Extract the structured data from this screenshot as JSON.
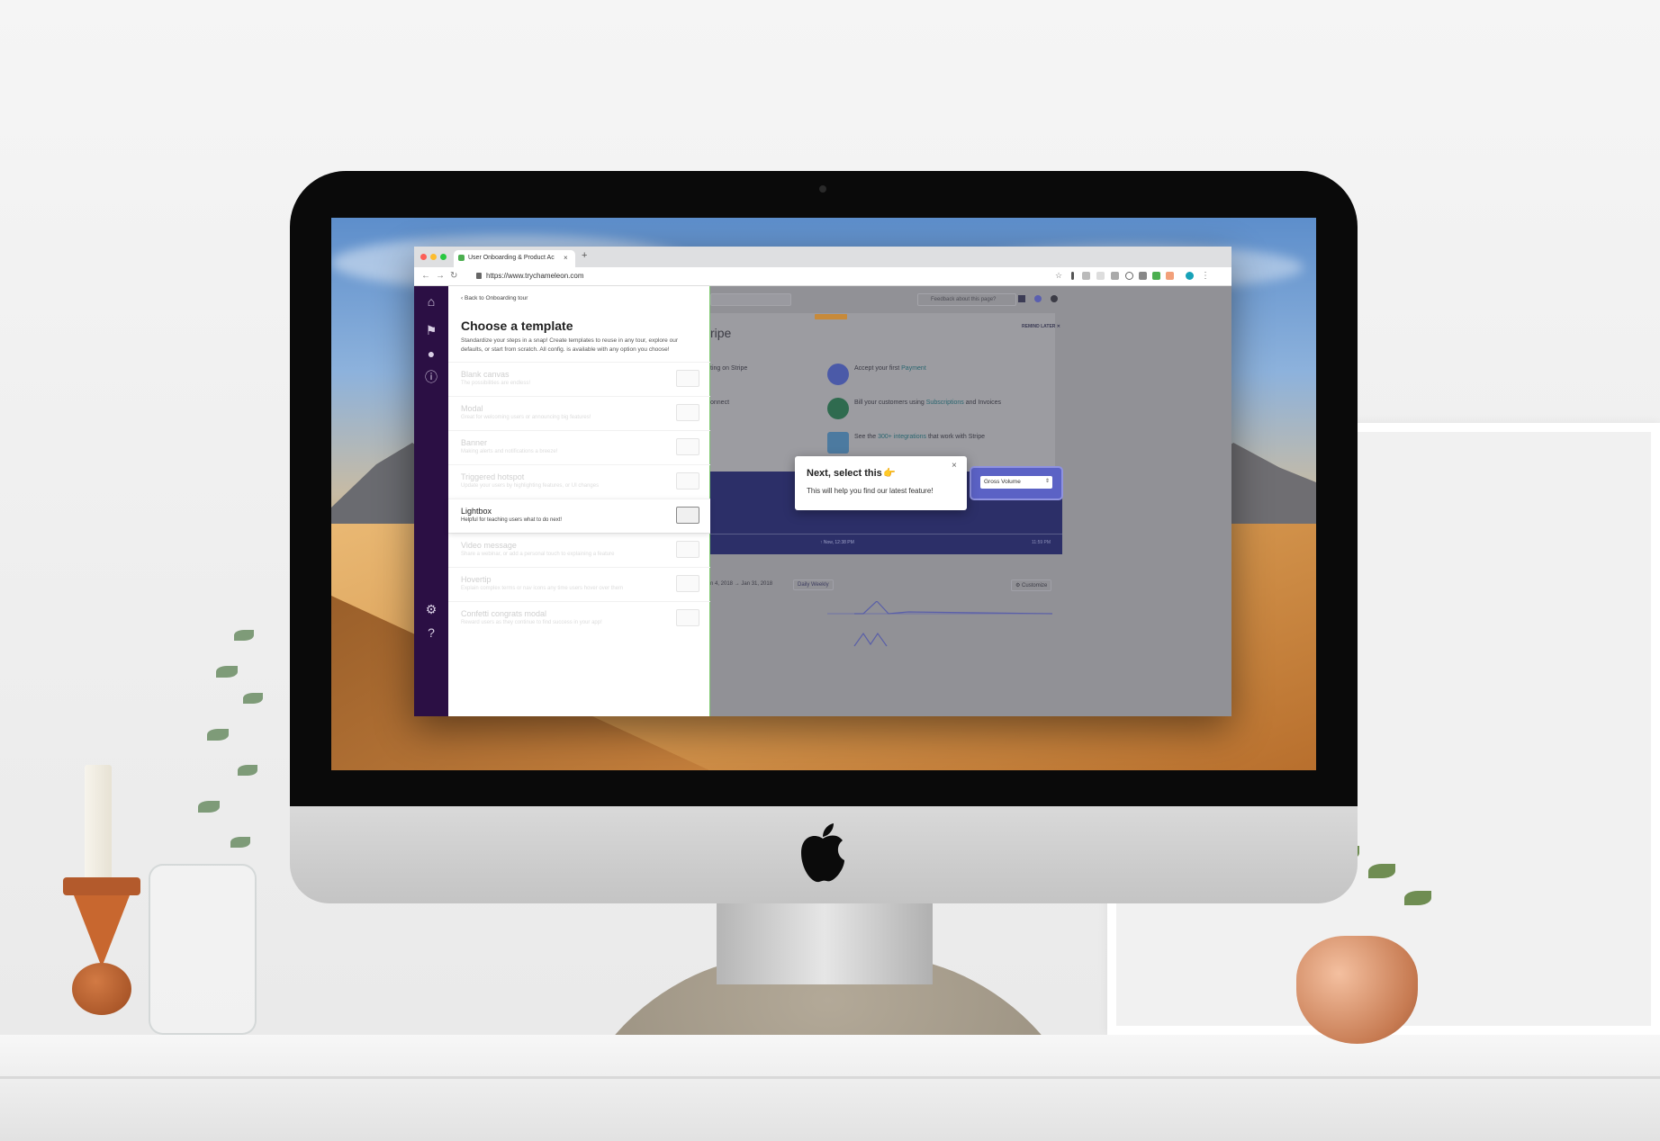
{
  "browser": {
    "tab_title": "User Onboarding & Product Ac",
    "tab_close": "×",
    "new_tab": "+",
    "url": "https://www.trychameleon.com",
    "nav_back": "←",
    "nav_forward": "→",
    "nav_reload": "↻",
    "bookmark_star": "☆"
  },
  "panel": {
    "back_link": "Back to Onboarding tour",
    "title": "Choose a template",
    "description": "Standardize your steps in a snap! Create templates to reuse in any tour, explore our defaults, or start from scratch. All config. is available with any option you choose!",
    "templates": [
      {
        "title": "Blank canvas",
        "desc": "The possibilities are endless!"
      },
      {
        "title": "Modal",
        "desc": "Great for welcoming users or announcing big features!"
      },
      {
        "title": "Banner",
        "desc": "Making alerts and notifications a breeze!"
      },
      {
        "title": "Triggered hotspot",
        "desc": "Update your users by highlighting features, or UI changes"
      },
      {
        "title": "Lightbox",
        "desc": "Helpful for teaching users what to do next!"
      },
      {
        "title": "Video message",
        "desc": "Share a webinar, or add a personal touch to explaining a feature"
      },
      {
        "title": "Hovertip",
        "desc": "Explain complex terms or nav icons any time users hover over them"
      },
      {
        "title": "Confetti congrats modal",
        "desc": "Reward users as they continue to find success in your app!"
      }
    ],
    "active_index": 4
  },
  "dashboard": {
    "feedback": "Feedback about this page?",
    "title_fragment": "ripe",
    "remind_later": "REMIND LATER ✕",
    "row_left_1": "ting on Stripe",
    "row_left_2": "onnect",
    "row_1_pre": "Accept your first",
    "row_1_link": "Payment",
    "row_2_pre": "Bill your customers using",
    "row_2_link": "Subscriptions",
    "row_2_post": "and Invoices",
    "row_3_pre": "See the",
    "row_3_link": "300+ integrations",
    "row_3_post": "that work with Stripe",
    "chart_now": "↑ Now, 12:38 PM",
    "chart_end": "11:59 PM",
    "dates": "n 4, 2018   → Jan 31, 2018",
    "daily_weekly": "Daily  Weekly",
    "customize": "⚙ Customize"
  },
  "target": {
    "select_value": "Gross Volume",
    "caret": "⇕"
  },
  "tooltip": {
    "title": "Next, select this",
    "pointer": "👉",
    "body": "This will help you find our latest feature!",
    "close": "×"
  },
  "colors": {
    "sidebar": "#2b0f44",
    "accent_green": "#7bc96e",
    "chart_navy": "#2c2f68",
    "target_blue": "#5b62c5"
  }
}
